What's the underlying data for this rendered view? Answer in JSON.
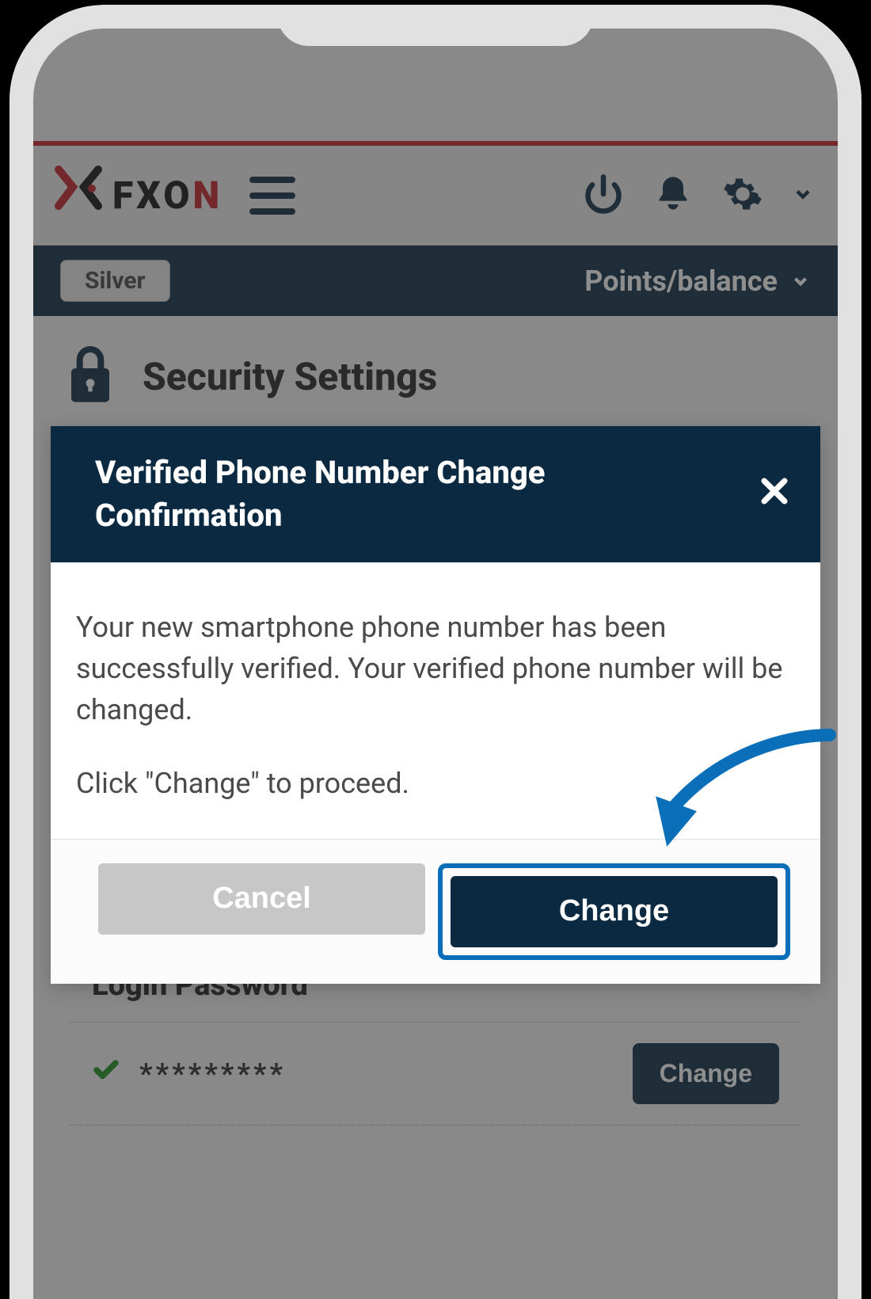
{
  "header": {
    "logo_text": "FXON",
    "power_icon": "power-icon",
    "bell_icon": "bell-icon",
    "gear_icon": "gear-icon"
  },
  "status_bar": {
    "tier_badge": "Silver",
    "points_label": "Points/balance"
  },
  "page": {
    "title": "Security Settings"
  },
  "login_password": {
    "section_label": "Login Password",
    "masked_value": "*********",
    "change_button": "Change"
  },
  "modal": {
    "title": "Verified Phone Number Change Confirmation",
    "body_p1": "Your new smartphone phone number has been successfully verified. Your verified phone number will be changed.",
    "body_p2": "Click \"Change\" to proceed.",
    "cancel_button": "Cancel",
    "change_button": "Change"
  }
}
